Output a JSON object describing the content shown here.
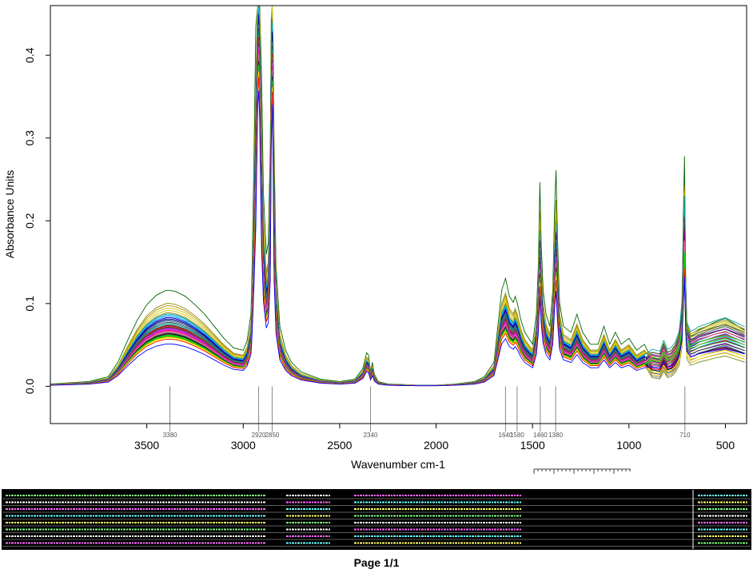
{
  "chart_data": {
    "type": "line",
    "title": "",
    "xlabel": "Wavenumber cm-1",
    "ylabel": "Absorbance Units",
    "x_reversed": true,
    "xlim": [
      4000,
      390
    ],
    "ylim": [
      -0.045,
      0.46
    ],
    "xticks": [
      3500,
      3000,
      2500,
      2000,
      1500,
      1000,
      500
    ],
    "yticks": [
      0.0,
      0.1,
      0.2,
      0.3,
      0.4
    ],
    "ytick_labels": [
      "0.0",
      "0.1",
      "0.2",
      "0.3",
      "0.4"
    ],
    "grid": false,
    "legend": "none",
    "peak_labels": [
      {
        "x": 3380,
        "label": "3380"
      },
      {
        "x": 2920,
        "label": "2920"
      },
      {
        "x": 2850,
        "label": "2850"
      },
      {
        "x": 2340,
        "label": "2340"
      },
      {
        "x": 1640,
        "label": "1640"
      },
      {
        "x": 1580,
        "label": "1580"
      },
      {
        "x": 1460,
        "label": "1460"
      },
      {
        "x": 1380,
        "label": "1380"
      },
      {
        "x": 710,
        "label": "710"
      }
    ],
    "series_count": 40,
    "colors": [
      "#006400",
      "#8b8b00",
      "#b8860b",
      "#c8c800",
      "#d4c000",
      "#808000",
      "#00a0a0",
      "#00bfff",
      "#1e90ff",
      "#0000cd",
      "#00008b",
      "#191970",
      "#4682b4",
      "#2f4f4f",
      "#008b8b",
      "#20b2aa",
      "#8b0000",
      "#b22222",
      "#a0522d",
      "#8b4513",
      "#800080",
      "#9932cc",
      "#ba55d3",
      "#ff00ff",
      "#c71585",
      "#ff1493",
      "#db7093",
      "#ff69b4",
      "#808080",
      "#696969",
      "#000000",
      "#333333",
      "#228b22",
      "#00ff00",
      "#00cd00",
      "#6b8e23",
      "#ffd700",
      "#ffff00",
      "#ff0000",
      "#0000ff"
    ],
    "series_scales": [
      1.0,
      0.78,
      0.74,
      0.7,
      0.66,
      0.62,
      0.6,
      0.58,
      0.56,
      0.54,
      0.52,
      0.5,
      0.48,
      0.46,
      0.44,
      0.42,
      0.41,
      0.4,
      0.39,
      0.38,
      0.37,
      0.36,
      0.35,
      0.34,
      0.33,
      0.32,
      0.31,
      0.3,
      0.29,
      0.28,
      0.27,
      0.26,
      0.25,
      0.24,
      0.23,
      0.22,
      0.21,
      0.2,
      0.18,
      0.1
    ],
    "reference_spectrum": {
      "x": [
        3999,
        3900,
        3800,
        3700,
        3650,
        3600,
        3550,
        3500,
        3450,
        3400,
        3380,
        3350,
        3300,
        3250,
        3200,
        3150,
        3100,
        3050,
        3000,
        2980,
        2960,
        2955,
        2945,
        2935,
        2925,
        2920,
        2915,
        2905,
        2895,
        2880,
        2870,
        2860,
        2855,
        2850,
        2845,
        2840,
        2830,
        2810,
        2780,
        2750,
        2700,
        2600,
        2500,
        2420,
        2380,
        2360,
        2350,
        2340,
        2330,
        2320,
        2300,
        2250,
        2100,
        2000,
        1900,
        1800,
        1750,
        1700,
        1680,
        1660,
        1640,
        1620,
        1600,
        1590,
        1580,
        1560,
        1540,
        1520,
        1500,
        1480,
        1470,
        1462,
        1455,
        1445,
        1430,
        1410,
        1395,
        1385,
        1378,
        1370,
        1360,
        1340,
        1300,
        1270,
        1240,
        1200,
        1160,
        1130,
        1100,
        1070,
        1040,
        1000,
        960,
        920,
        880,
        840,
        820,
        800,
        780,
        760,
        740,
        725,
        718,
        712,
        706,
        700,
        690,
        680,
        660,
        640,
        600,
        550,
        500,
        450,
        400
      ],
      "y": [
        0.002,
        0.003,
        0.004,
        0.008,
        0.02,
        0.038,
        0.055,
        0.068,
        0.076,
        0.08,
        0.08,
        0.079,
        0.075,
        0.068,
        0.06,
        0.05,
        0.04,
        0.032,
        0.03,
        0.038,
        0.06,
        0.09,
        0.18,
        0.3,
        0.4,
        0.42,
        0.38,
        0.26,
        0.16,
        0.11,
        0.12,
        0.2,
        0.34,
        0.4,
        0.32,
        0.2,
        0.1,
        0.05,
        0.03,
        0.02,
        0.012,
        0.006,
        0.004,
        0.006,
        0.015,
        0.028,
        0.026,
        0.012,
        0.02,
        0.01,
        0.004,
        0.002,
        0.001,
        0.001,
        0.002,
        0.004,
        0.008,
        0.02,
        0.05,
        0.08,
        0.09,
        0.075,
        0.07,
        0.075,
        0.07,
        0.055,
        0.045,
        0.04,
        0.035,
        0.06,
        0.1,
        0.17,
        0.12,
        0.08,
        0.06,
        0.05,
        0.08,
        0.15,
        0.18,
        0.12,
        0.07,
        0.05,
        0.045,
        0.06,
        0.045,
        0.035,
        0.035,
        0.05,
        0.035,
        0.045,
        0.035,
        0.04,
        0.03,
        0.035,
        0.03,
        0.028,
        0.04,
        0.03,
        0.032,
        0.038,
        0.05,
        0.08,
        0.15,
        0.2,
        0.1,
        0.06,
        0.055,
        0.05,
        0.052,
        0.055,
        0.058,
        0.062,
        0.065,
        0.06,
        0.055
      ]
    }
  },
  "table": {
    "row_count": 8
  },
  "footer": {
    "page_label": "Page 1/1"
  }
}
